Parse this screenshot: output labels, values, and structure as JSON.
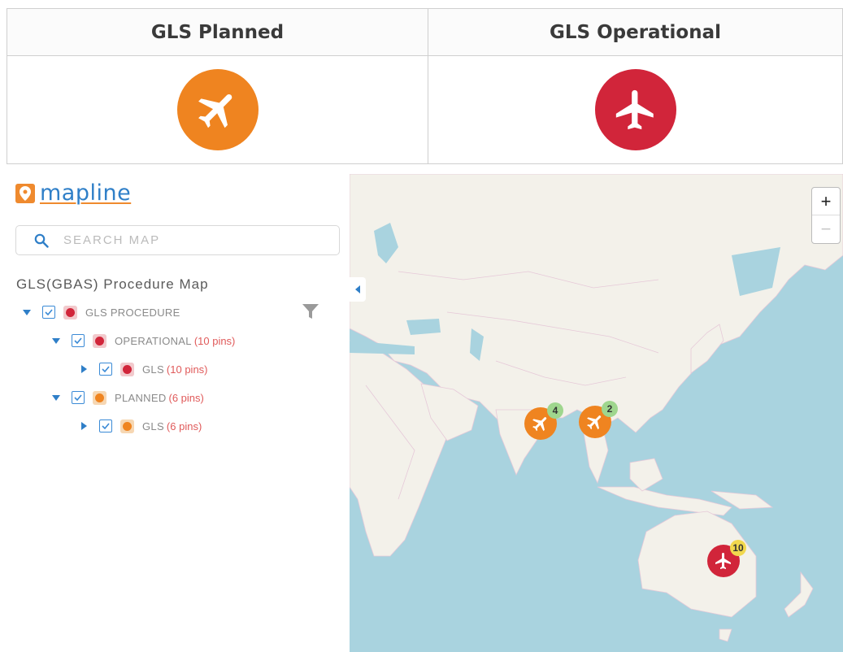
{
  "legend": {
    "planned": {
      "label": "GLS Planned",
      "color": "#ef8420",
      "icon": "airplane-icon"
    },
    "operational": {
      "label": "GLS Operational",
      "color": "#d1253a",
      "icon": "airplane-icon"
    }
  },
  "sidebar": {
    "logo_text": "mapline",
    "search_placeholder": "SEARCH MAP",
    "map_title": "GLS(GBAS) Procedure Map",
    "tree": {
      "root": {
        "label": "GLS PROCEDURE",
        "count": ""
      },
      "operational": {
        "label": "OPERATIONAL",
        "count": "(10 pins)"
      },
      "operational_child": {
        "label": "GLS",
        "count": "(10 pins)"
      },
      "planned": {
        "label": "PLANNED",
        "count": "(6 pins)"
      },
      "planned_child": {
        "label": "GLS",
        "count": "(6 pins)"
      }
    }
  },
  "map": {
    "zoom_in": "+",
    "zoom_out": "−",
    "clusters": [
      {
        "region": "India",
        "count": "4",
        "status": "planned"
      },
      {
        "region": "Southeast Asia",
        "count": "2",
        "status": "planned"
      },
      {
        "region": "Australia",
        "count": "10",
        "status": "operational"
      }
    ]
  }
}
